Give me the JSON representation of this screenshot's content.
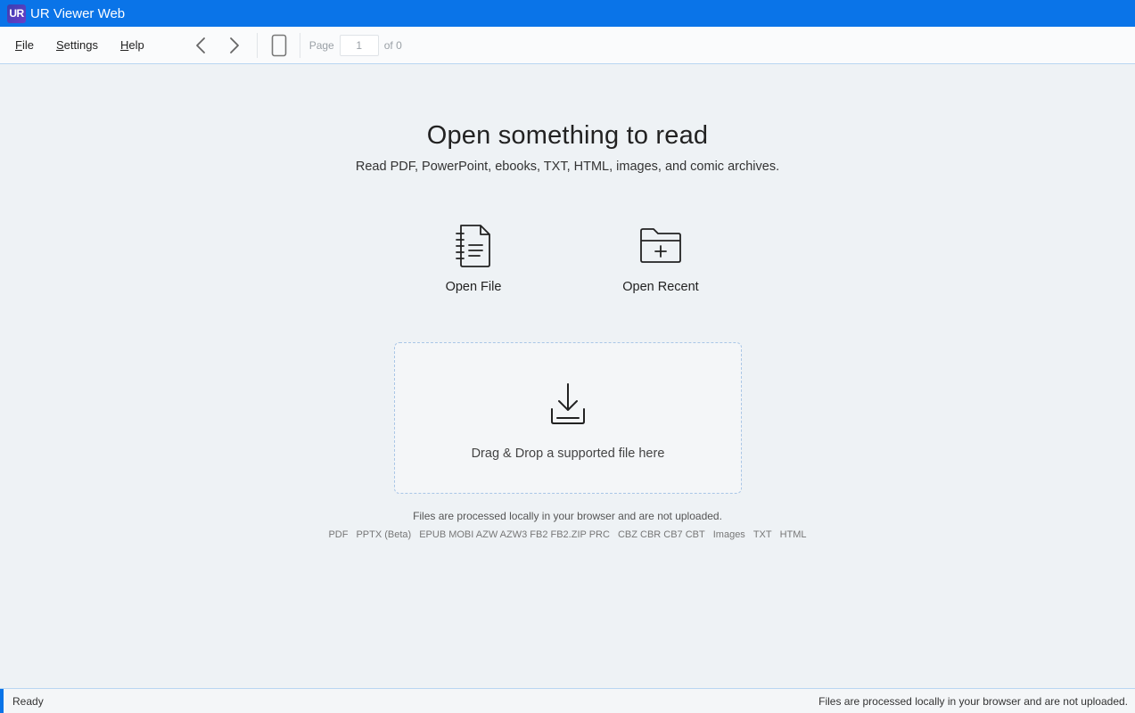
{
  "window": {
    "logo_text": "UR",
    "title": "UR Viewer Web"
  },
  "menu": {
    "file": {
      "mnemonic": "F",
      "rest": "ile"
    },
    "settings": {
      "mnemonic": "S",
      "rest": "ettings"
    },
    "help": {
      "mnemonic": "H",
      "rest": "elp"
    }
  },
  "toolbar": {
    "prev_icon": "chevron-left-icon",
    "next_icon": "chevron-right-icon",
    "view_icon": "single-page-icon",
    "page_label": "Page",
    "page_value": "1",
    "page_total": "of 0"
  },
  "main": {
    "headline": "Open something to read",
    "subline": "Read PDF, PowerPoint, ebooks, TXT, HTML, images, and comic archives.",
    "open_file": {
      "label": "Open File",
      "icon": "document-icon"
    },
    "open_recent": {
      "label": "Open Recent",
      "icon": "folder-plus-icon"
    },
    "dropzone": {
      "label": "Drag & Drop a supported file here",
      "icon": "download-tray-icon"
    },
    "privacy_note": "Files are processed locally in your browser and are not uploaded.",
    "formats": [
      "PDF",
      "PPTX (Beta)",
      "EPUB MOBI AZW AZW3 FB2 FB2.ZIP PRC",
      "CBZ CBR CB7 CBT",
      "Images",
      "TXT",
      "HTML"
    ]
  },
  "statusbar": {
    "left": "Ready",
    "right": "Files are processed locally in your browser and are not uploaded."
  },
  "colors": {
    "accent": "#0a74e8",
    "background": "#eef2f5"
  }
}
